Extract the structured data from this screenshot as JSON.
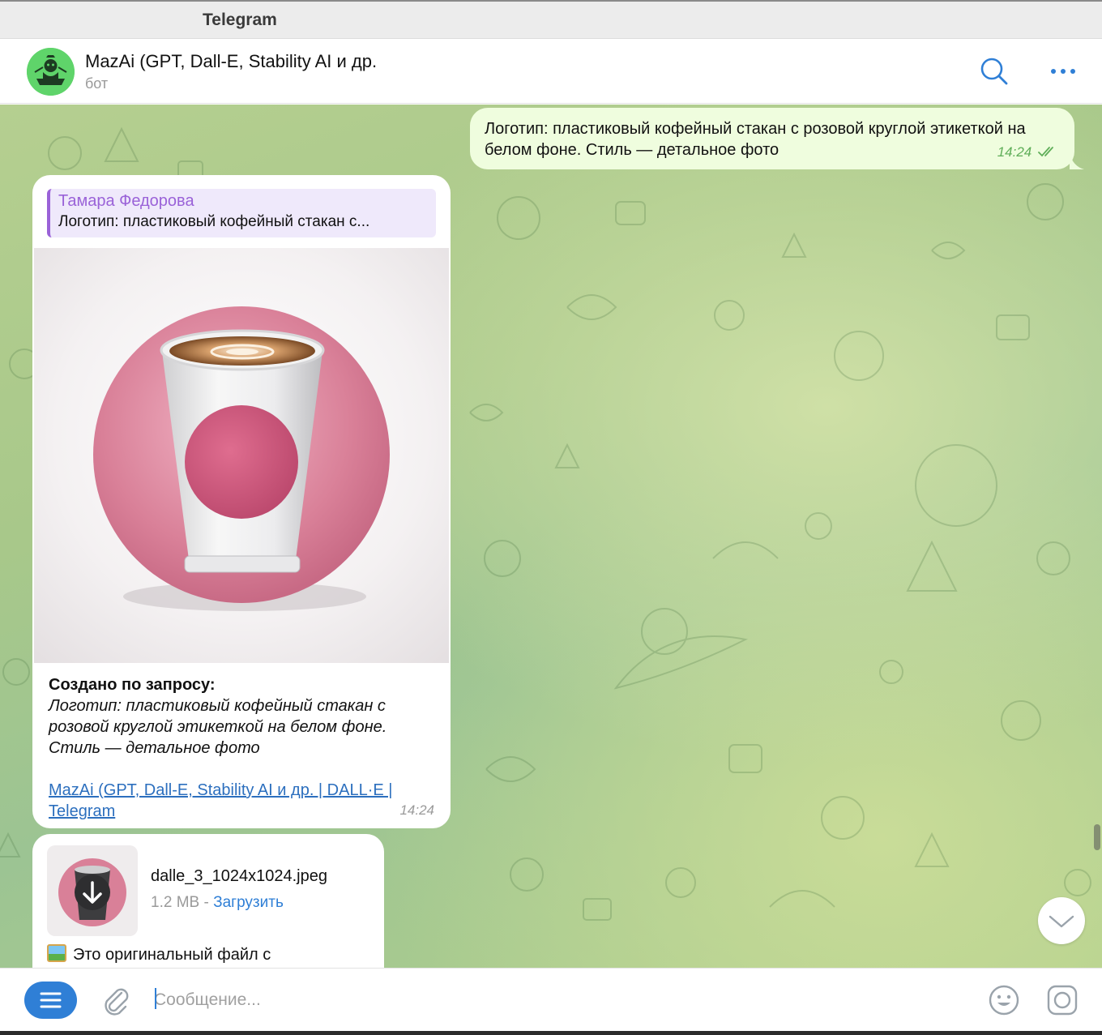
{
  "window": {
    "title": "Telegram"
  },
  "header": {
    "chat_name": "MazAi (GPT, Dall-E, Stability AI и др.",
    "chat_subtitle": "бот",
    "avatar_icon": "bot-avatar-icon",
    "search_icon": "search-icon",
    "more_icon": "more-dots-icon"
  },
  "messages": {
    "outgoing": {
      "text": "Логотип: пластиковый кофейный стакан с розовой круглой этикеткой на белом фоне. Стиль — детальное фото",
      "time": "14:24",
      "status_icon": "double-check-icon"
    },
    "incoming_photo": {
      "reply_author": "Тамара Федорова",
      "reply_text": "Логотип: пластиковый кофейный стакан с...",
      "caption_heading": "Создано по запросу:",
      "caption_body": "Логотип: пластиковый кофейный стакан с розовой круглой этикеткой на белом фоне. Стиль — детальное фото",
      "caption_link": "MazAi (GPT, Dall-E, Stability AI и др. | DALL·E | Telegram",
      "time": "14:24"
    },
    "incoming_file": {
      "file_name": "dalle_3_1024x1024.jpeg",
      "file_size": "1.2 MB",
      "separator": " - ",
      "download_label": "Загрузить",
      "note_text": "Это оригинальный файл с",
      "download_icon": "download-arrow-icon"
    }
  },
  "composer": {
    "placeholder": "Сообщение...",
    "menu_icon": "menu-lines-icon",
    "attach_icon": "paperclip-icon",
    "emoji_icon": "emoji-smile-icon",
    "camera_icon": "camera-icon"
  },
  "colors": {
    "accent": "#2f7fd6",
    "outgoing_bubble": "#effdde",
    "reply_accent": "#9a62d8",
    "check_green": "#5fae58"
  }
}
